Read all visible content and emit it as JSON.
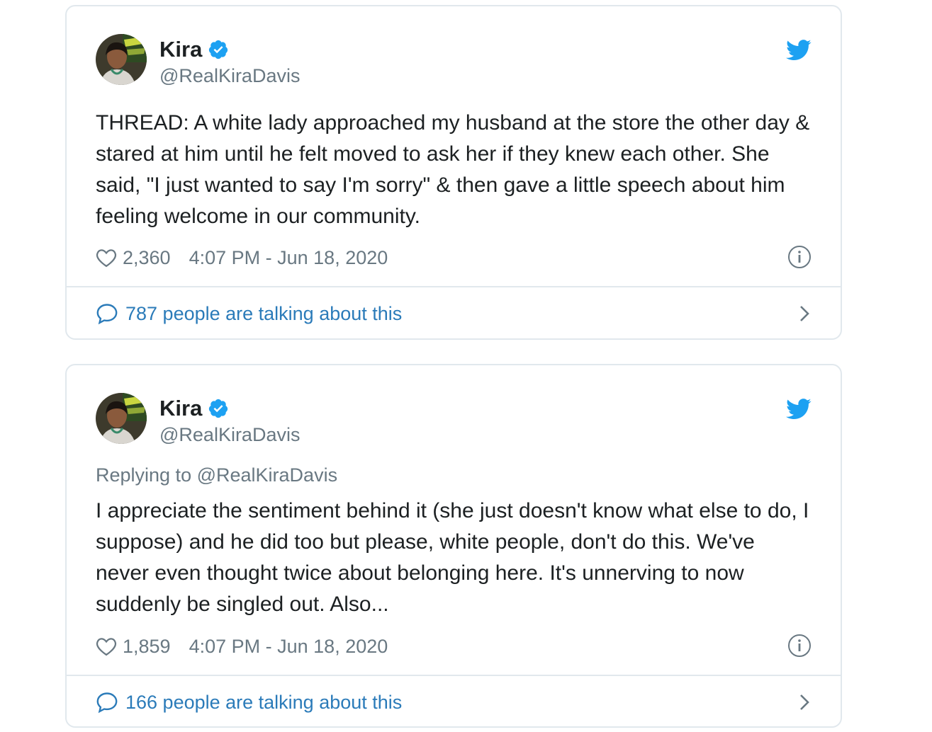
{
  "tweets": [
    {
      "author": {
        "display_name": "Kira",
        "handle": "@RealKiraDavis",
        "verified": true
      },
      "replying_to": "",
      "text": "THREAD: A white lady approached my husband at the store the other day & stared at him until he felt moved to ask her if they knew each other. She said, \"I just wanted to say I'm sorry\" & then gave a little speech about him feeling welcome in our community.",
      "likes": "2,360",
      "timestamp": "4:07 PM - Jun 18, 2020",
      "conversation_label": "787 people are talking about this"
    },
    {
      "author": {
        "display_name": "Kira",
        "handle": "@RealKiraDavis",
        "verified": true
      },
      "replying_to_prefix": "Replying to",
      "replying_to": "@RealKiraDavis",
      "text": "I appreciate the sentiment behind it (she just doesn't know what else to do, I suppose) and he did too but please, white people, don't do this. We've never even thought twice about belonging here. It's unnerving to now suddenly be singled out. Also...",
      "likes": "1,859",
      "timestamp": "4:07 PM - Jun 18, 2020",
      "conversation_label": "166 people are talking about this"
    }
  ],
  "icons": {
    "brand": "twitter-bird-icon",
    "verified": "verified-badge-icon",
    "like": "heart-icon",
    "info": "info-icon",
    "conversation": "speech-bubble-icon",
    "navigate": "chevron-right-icon"
  },
  "colors": {
    "twitter_blue": "#1da1f2",
    "link_blue": "#2b7bb9",
    "text": "#1c2022",
    "muted": "#697882",
    "border": "#e1e8ed"
  }
}
